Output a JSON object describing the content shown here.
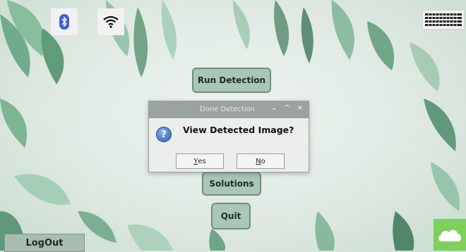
{
  "tray": {
    "bluetooth_icon": "bluetooth-icon",
    "wifi_icon": "wifi-icon"
  },
  "keyboard_icon": "keyboard-icon",
  "buttons": {
    "run_detection": "Run Detection",
    "solutions": "Solutions",
    "quit": "Quit",
    "logout": "LogOut"
  },
  "dialog": {
    "title": "Done Detection",
    "controls": [
      "⌄",
      "^",
      "×"
    ],
    "message": "View Detected Image?",
    "yes_first": "Y",
    "yes_rest": "es",
    "no_first": "N",
    "no_rest": "o",
    "icon": "question-icon"
  },
  "cloud_icon": "cloud-icon",
  "colors": {
    "button_bg": "#a8c7b5",
    "dialog_title_bg": "#9aa39f",
    "cloud_tile": "#7ecf5c"
  }
}
